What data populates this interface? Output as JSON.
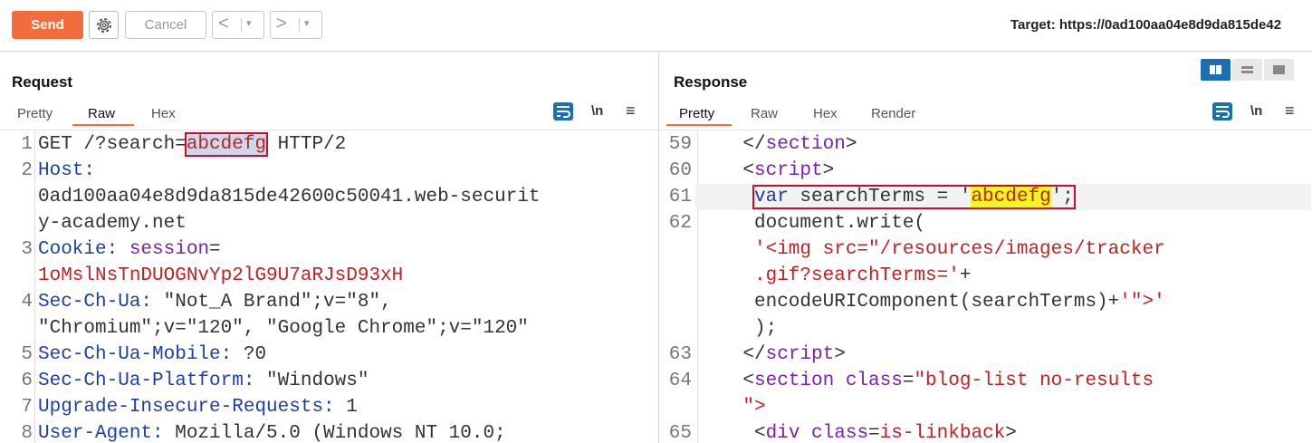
{
  "toolbar": {
    "send_label": "Send",
    "cancel_label": "Cancel",
    "back_arrow": "<",
    "forward_arrow": ">",
    "dropdown_glyph": "▾",
    "target_text": "Target: https://0ad100aa04e8d9da815de42"
  },
  "request": {
    "title": "Request",
    "tabs": [
      "Pretty",
      "Raw",
      "Hex"
    ],
    "active_tab": "Raw",
    "lines": [
      {
        "n": "1",
        "parts": [
          [
            "GET /?search=",
            "dark"
          ],
          [
            "abcdefg",
            "red-hl"
          ],
          [
            " HTTP/2",
            "dark"
          ]
        ]
      },
      {
        "n": "2",
        "parts": [
          [
            "Host:",
            "blue"
          ]
        ]
      },
      {
        "n": "",
        "parts": [
          [
            "0ad100aa04e8d9da815de42600c50041.web-securit",
            "dark"
          ]
        ]
      },
      {
        "n": "",
        "parts": [
          [
            "y-academy.net",
            "dark"
          ]
        ]
      },
      {
        "n": "3",
        "parts": [
          [
            "Cookie: ",
            "blue"
          ],
          [
            "session",
            "purple"
          ],
          [
            "=",
            "dark"
          ]
        ]
      },
      {
        "n": "",
        "parts": [
          [
            "1oMslNsTnDUOGNvYp2lG9U7aRJsD93xH",
            "red"
          ]
        ]
      },
      {
        "n": "4",
        "parts": [
          [
            "Sec-Ch-Ua:",
            "blue"
          ],
          [
            " \"Not_A Brand\";v=\"8\",",
            "dark"
          ]
        ]
      },
      {
        "n": "",
        "parts": [
          [
            "\"Chromium\";v=\"120\", \"Google Chrome\";v=\"120\"",
            "dark"
          ]
        ]
      },
      {
        "n": "5",
        "parts": [
          [
            "Sec-Ch-Ua-Mobile:",
            "blue"
          ],
          [
            " ?0",
            "dark"
          ]
        ]
      },
      {
        "n": "6",
        "parts": [
          [
            "Sec-Ch-Ua-Platform:",
            "blue"
          ],
          [
            " \"Windows\"",
            "dark"
          ]
        ]
      },
      {
        "n": "7",
        "parts": [
          [
            "Upgrade-Insecure-Requests:",
            "blue"
          ],
          [
            " 1",
            "dark"
          ]
        ]
      },
      {
        "n": "8",
        "parts": [
          [
            "User-Agent:",
            "blue"
          ],
          [
            " Mozilla/5.0 (Windows NT 10.0;",
            "dark"
          ]
        ]
      }
    ]
  },
  "response": {
    "title": "Response",
    "tabs": [
      "Pretty",
      "Raw",
      "Hex",
      "Render"
    ],
    "active_tab": "Pretty",
    "lines": [
      {
        "n": "59",
        "indent": 4,
        "parts": [
          [
            "</",
            "dark"
          ],
          [
            "section",
            "purple"
          ],
          [
            ">",
            "dark"
          ]
        ]
      },
      {
        "n": "60",
        "indent": 4,
        "parts": [
          [
            "<",
            "dark"
          ],
          [
            "script",
            "purple"
          ],
          [
            ">",
            "dark"
          ]
        ]
      },
      {
        "n": "61",
        "indent": 5,
        "highlight": true,
        "parts": [
          [
            "var",
            "blue"
          ],
          [
            " searchTerms = '",
            "dark"
          ],
          [
            "abcdefg",
            "yellow-hl"
          ],
          [
            "';",
            "dark"
          ]
        ]
      },
      {
        "n": "62",
        "indent": 5,
        "parts": [
          [
            "document.write(",
            "dark"
          ]
        ]
      },
      {
        "n": "",
        "indent": 5,
        "parts": [
          [
            "'<img src=\"/resources/images/tracker",
            "red"
          ]
        ]
      },
      {
        "n": "",
        "indent": 5,
        "parts": [
          [
            ".gif?searchTerms='",
            "red"
          ],
          [
            "+",
            "dark"
          ]
        ]
      },
      {
        "n": "",
        "indent": 5,
        "parts": [
          [
            "encodeURIComponent(searchTerms)+",
            "dark"
          ],
          [
            "'\">'",
            "red"
          ]
        ]
      },
      {
        "n": "",
        "indent": 5,
        "parts": [
          [
            ");",
            "dark"
          ]
        ]
      },
      {
        "n": "63",
        "indent": 4,
        "parts": [
          [
            "</",
            "dark"
          ],
          [
            "script",
            "purple"
          ],
          [
            ">",
            "dark"
          ]
        ]
      },
      {
        "n": "64",
        "indent": 4,
        "parts": [
          [
            "<",
            "dark"
          ],
          [
            "section",
            "purple"
          ],
          [
            " ",
            "dark"
          ],
          [
            "class",
            "purple"
          ],
          [
            "=",
            "dark"
          ],
          [
            "\"blog-list no-results",
            "red"
          ]
        ]
      },
      {
        "n": "",
        "indent": 4,
        "parts": [
          [
            "\">",
            "red"
          ]
        ]
      },
      {
        "n": "65",
        "indent": 5,
        "parts": [
          [
            "<",
            "dark"
          ],
          [
            "div",
            "purple"
          ],
          [
            " ",
            "dark"
          ],
          [
            "class",
            "purple"
          ],
          [
            "=",
            "dark"
          ],
          [
            "is-linkback",
            "red"
          ],
          [
            ">",
            "dark"
          ]
        ]
      }
    ]
  },
  "icons": {
    "newline_glyph": "\\n",
    "menu_glyph": "≡"
  },
  "colors": {
    "accent": "#f26d3d",
    "wrap_icon": "#1b6fb5",
    "highlight_border": "#c8102e",
    "highlight_yellow": "#f4f420"
  }
}
